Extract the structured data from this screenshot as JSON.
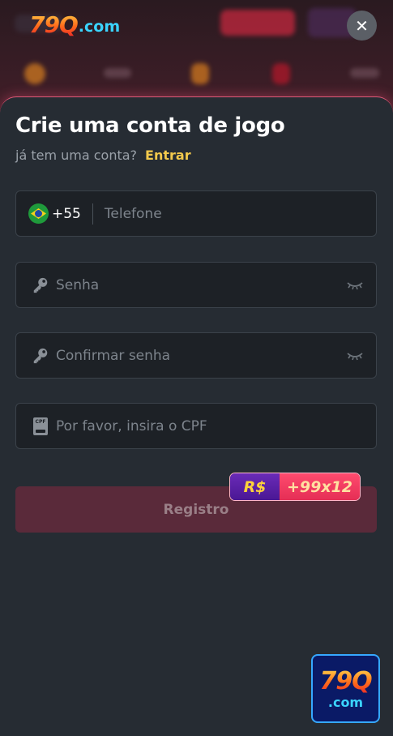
{
  "header": {
    "logo_main": "79Q",
    "logo_suffix": ".com",
    "close_icon": "close-icon"
  },
  "form": {
    "title": "Crie uma conta de jogo",
    "have_account_text": "já tem uma conta?",
    "login_link": "Entrar",
    "phone": {
      "country_code": "+55",
      "placeholder": "Telefone",
      "flag_icon": "brazil-flag-icon"
    },
    "password": {
      "placeholder": "Senha",
      "icon": "key-icon",
      "toggle_icon": "eye-closed-icon"
    },
    "confirm_password": {
      "placeholder": "Confirmar senha",
      "icon": "key-icon",
      "toggle_icon": "eye-closed-icon"
    },
    "cpf": {
      "placeholder": "Por favor, insira o CPF",
      "icon": "id-card-icon",
      "icon_text": "CPF"
    },
    "register_button": "Registro",
    "bonus": {
      "currency": "R$",
      "amount": "+99x12"
    }
  },
  "app_badge": {
    "main": "79Q",
    "suffix": ".com"
  },
  "colors": {
    "accent_yellow": "#f2c94c",
    "register_bg": "#5a2a3a",
    "sheet_bg": "#262c33",
    "bonus_purple": "#5a22a8",
    "bonus_pink": "#ef3a60"
  }
}
